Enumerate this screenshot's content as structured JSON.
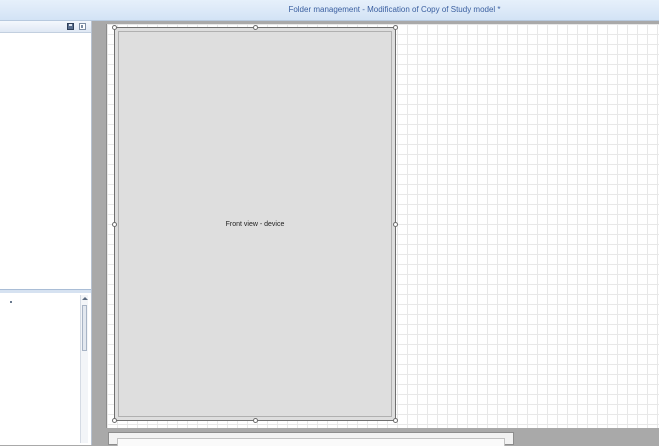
{
  "window": {
    "title": "Folder  management - Modification of Copy of  Study model *"
  },
  "left_panel": {
    "header_icons": [
      "save-icon",
      "dock-icon"
    ]
  },
  "canvas": {
    "device": {
      "label": "Front view - device"
    }
  },
  "colors": {
    "workspace_background": "#a9a9a9",
    "device_fill": "#dedede",
    "title_text": "#3a5fa0"
  }
}
